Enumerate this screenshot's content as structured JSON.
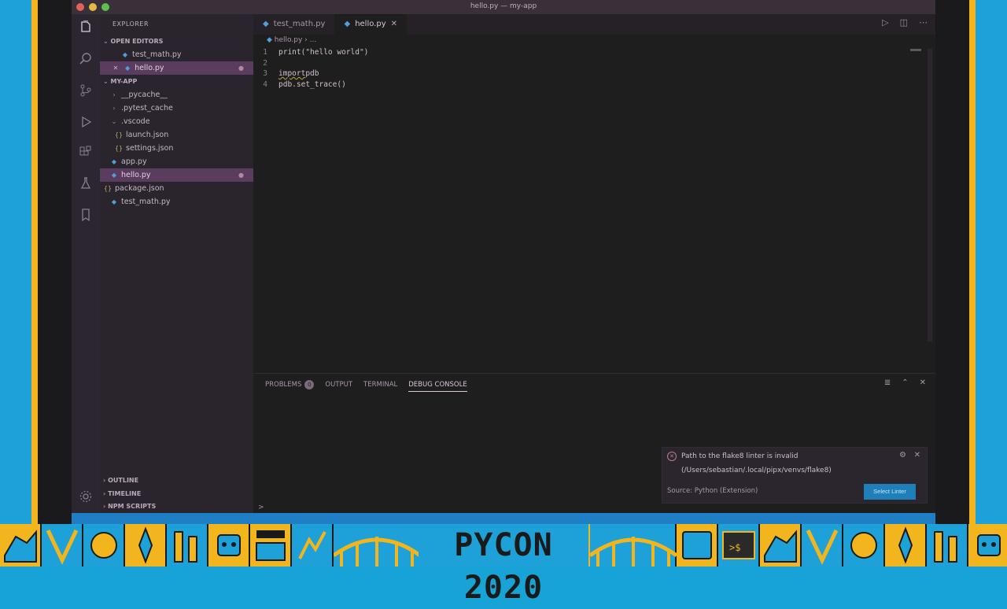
{
  "window": {
    "title": "hello.py — my-app"
  },
  "activitybar": {
    "icons": [
      "files-icon",
      "search-icon",
      "source-control-icon",
      "run-debug-icon",
      "extensions-icon",
      "testing-icon",
      "bookmark-icon",
      "gear-icon"
    ]
  },
  "sidebar": {
    "title": "EXPLORER",
    "open_editors_label": "OPEN EDITORS",
    "open_editors": [
      {
        "name": "test_math.py"
      },
      {
        "name": "hello.py"
      }
    ],
    "project_label": "MY-APP",
    "tree": [
      {
        "name": "__pycache__",
        "type": "folder"
      },
      {
        "name": ".pytest_cache",
        "type": "folder"
      },
      {
        "name": ".vscode",
        "type": "folder-open"
      },
      {
        "name": "launch.json",
        "type": "json"
      },
      {
        "name": "settings.json",
        "type": "json"
      },
      {
        "name": "app.py",
        "type": "py"
      },
      {
        "name": "hello.py",
        "type": "py"
      },
      {
        "name": "package.json",
        "type": "json"
      },
      {
        "name": "test_math.py",
        "type": "py"
      }
    ],
    "outline_label": "OUTLINE",
    "timeline_label": "TIMELINE",
    "npm_label": "NPM SCRIPTS"
  },
  "tabs": [
    {
      "label": "test_math.py"
    },
    {
      "label": "hello.py"
    }
  ],
  "breadcrumb": {
    "file": "hello.py",
    "more": "..."
  },
  "code": {
    "lines": [
      {
        "num": "1",
        "text": "print(\"hello world\")"
      },
      {
        "num": "2",
        "text": ""
      },
      {
        "num": "3",
        "keyword": "import",
        "text": " pdb"
      },
      {
        "num": "4",
        "text": "pdb.set_trace()"
      }
    ]
  },
  "panel": {
    "tabs": [
      {
        "label": "PROBLEMS",
        "badge": "0"
      },
      {
        "label": "OUTPUT"
      },
      {
        "label": "TERMINAL"
      },
      {
        "label": "DEBUG CONSOLE"
      }
    ],
    "prompt": ">"
  },
  "notification": {
    "message": "Path to the flake8 linter is invalid",
    "path": "(/Users/sebastian/.local/pipx/venvs/flake8)",
    "source": "Source: Python (Extension)",
    "button": "Select Linter"
  },
  "banner": {
    "text": "PYCON 2020"
  },
  "colors": {
    "accent_blue": "#1da1d8",
    "accent_yellow": "#f2b51d",
    "status_bar": "#1e7fc4",
    "selection": "#5a3c5e"
  }
}
